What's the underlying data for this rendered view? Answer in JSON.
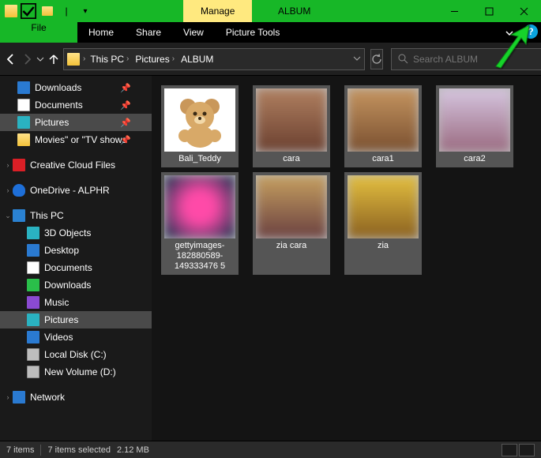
{
  "window_title": "ALBUM",
  "context_tab": "Manage",
  "subtab_label": "Picture Tools",
  "tabs": {
    "file": "File",
    "home": "Home",
    "share": "Share",
    "view": "View"
  },
  "breadcrumbs": [
    "This PC",
    "Pictures",
    "ALBUM"
  ],
  "search": {
    "placeholder": "Search ALBUM"
  },
  "sidebar": {
    "quick": [
      {
        "label": "Downloads",
        "icon": "blue",
        "pinned": true
      },
      {
        "label": "Documents",
        "icon": "doc",
        "pinned": true
      },
      {
        "label": "Pictures",
        "icon": "teal",
        "pinned": true,
        "selected": true
      },
      {
        "label": "Movies\" or \"TV shows",
        "icon": "folder",
        "pinned": true
      }
    ],
    "creative": {
      "label": "Creative Cloud Files",
      "icon": "cc"
    },
    "onedrive": {
      "label": "OneDrive - ALPHR",
      "icon": "cloud"
    },
    "thispc": {
      "label": "This PC",
      "icon": "pc"
    },
    "thispc_children": [
      {
        "label": "3D Objects",
        "icon": "teal"
      },
      {
        "label": "Desktop",
        "icon": "blue"
      },
      {
        "label": "Documents",
        "icon": "doc"
      },
      {
        "label": "Downloads",
        "icon": "green"
      },
      {
        "label": "Music",
        "icon": "purple"
      },
      {
        "label": "Pictures",
        "icon": "teal",
        "selected": true
      },
      {
        "label": "Videos",
        "icon": "blue"
      },
      {
        "label": "Local Disk (C:)",
        "icon": "drive"
      },
      {
        "label": "New Volume (D:)",
        "icon": "drive"
      }
    ],
    "network": {
      "label": "Network",
      "icon": "neticon"
    }
  },
  "files": [
    {
      "name": "Bali_Teddy",
      "thumb": "teddy"
    },
    {
      "name": "cara",
      "thumb": "blur",
      "bg": "linear-gradient(#b08060,#6b4030)"
    },
    {
      "name": "cara1",
      "thumb": "blur",
      "bg": "linear-gradient(#c59560,#7a5030)"
    },
    {
      "name": "cara2",
      "thumb": "blur",
      "bg": "linear-gradient(#d6c6e0,#9a6a80)"
    },
    {
      "name": "gettyimages-182880589-149333476 5",
      "thumb": "blur",
      "bg": "radial-gradient(circle,#ff4aa8 30%,#083048)"
    },
    {
      "name": "zia cara",
      "thumb": "blur",
      "bg": "linear-gradient(#c6a060,#6a4040)"
    },
    {
      "name": "zia",
      "thumb": "blur",
      "bg": "linear-gradient(#e4c040,#8a6020)"
    }
  ],
  "status": {
    "items": "7 items",
    "selected": "7 items selected",
    "size": "2.12 MB"
  }
}
